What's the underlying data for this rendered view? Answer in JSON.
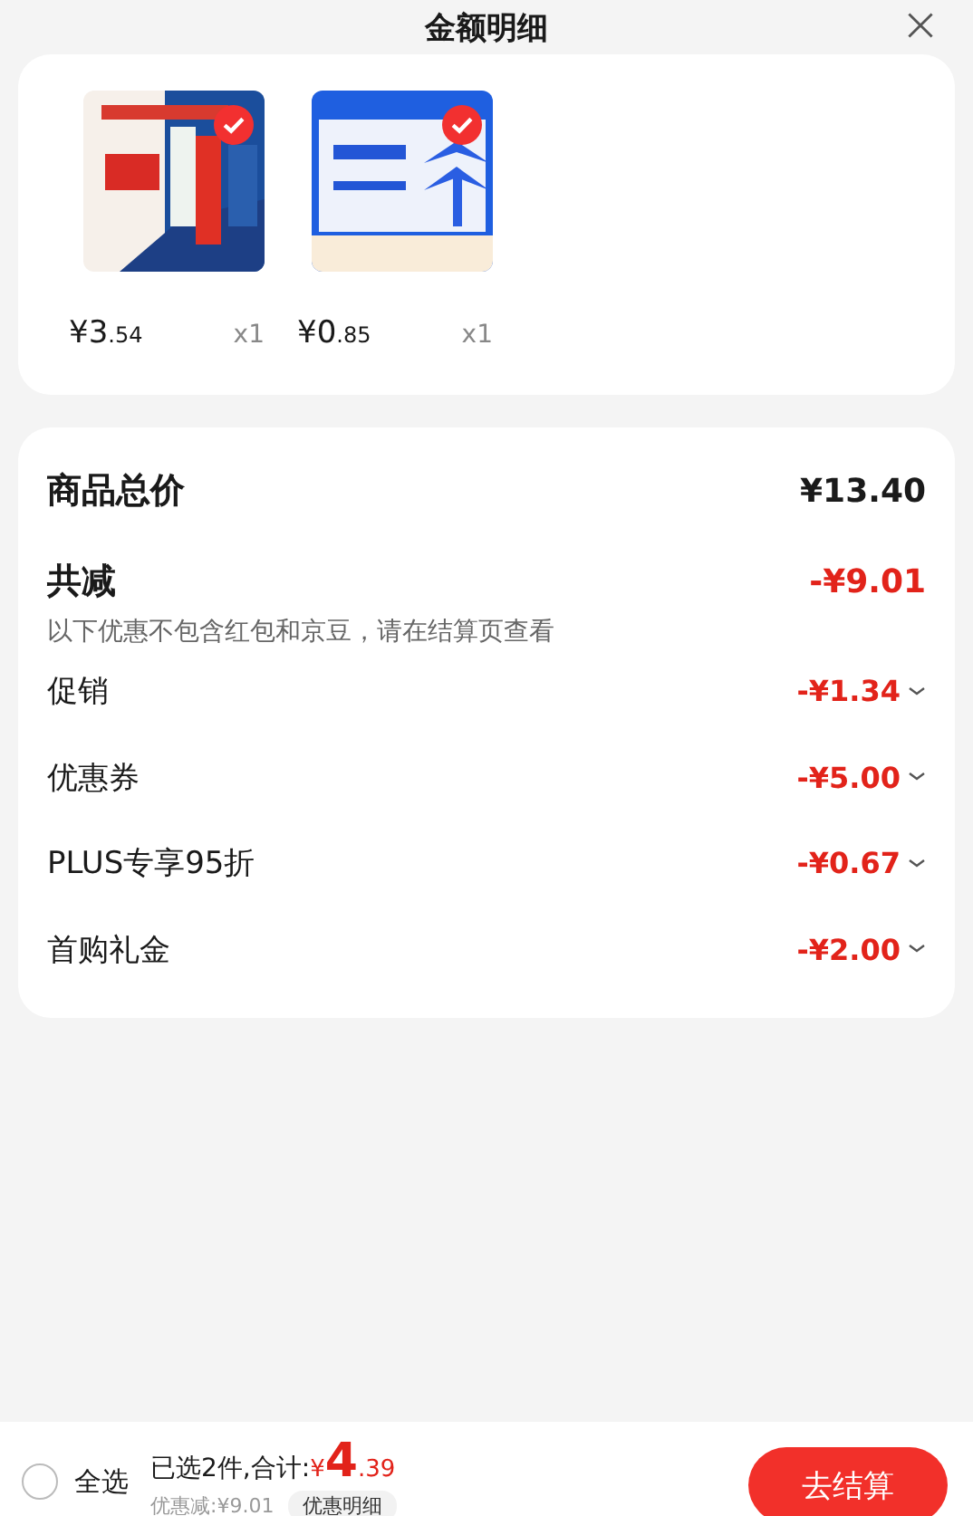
{
  "header": {
    "title": "金额明细"
  },
  "products": [
    {
      "kind": "picture",
      "checked": true,
      "price_int": "¥3",
      "price_dec": ".54",
      "quantity": "x1"
    },
    {
      "kind": "picture",
      "checked": true,
      "price_int": "¥0",
      "price_dec": ".85",
      "quantity": "x1"
    }
  ],
  "summary": {
    "total_label": "商品总价",
    "total_value": "¥13.40",
    "reduce_label": "共减",
    "reduce_value": "-¥9.01",
    "note": "以下优惠不包含红包和京豆，请在结算页查看",
    "discounts": [
      {
        "label": "促销",
        "value": "-¥1.34"
      },
      {
        "label": "优惠券",
        "value": "-¥5.00"
      },
      {
        "label": "PLUS专享95折",
        "value": "-¥0.67"
      },
      {
        "label": "首购礼金",
        "value": "-¥2.00"
      }
    ]
  },
  "footer": {
    "select_all": {
      "label": "全选",
      "checked": false
    },
    "selected_text": "已选2件,合计:",
    "total_symbol": "¥",
    "total_int": "4",
    "total_dec": ".39",
    "saved": "优惠减:¥9.01",
    "detail_button": "优惠明细",
    "checkout_button": "去结算"
  }
}
